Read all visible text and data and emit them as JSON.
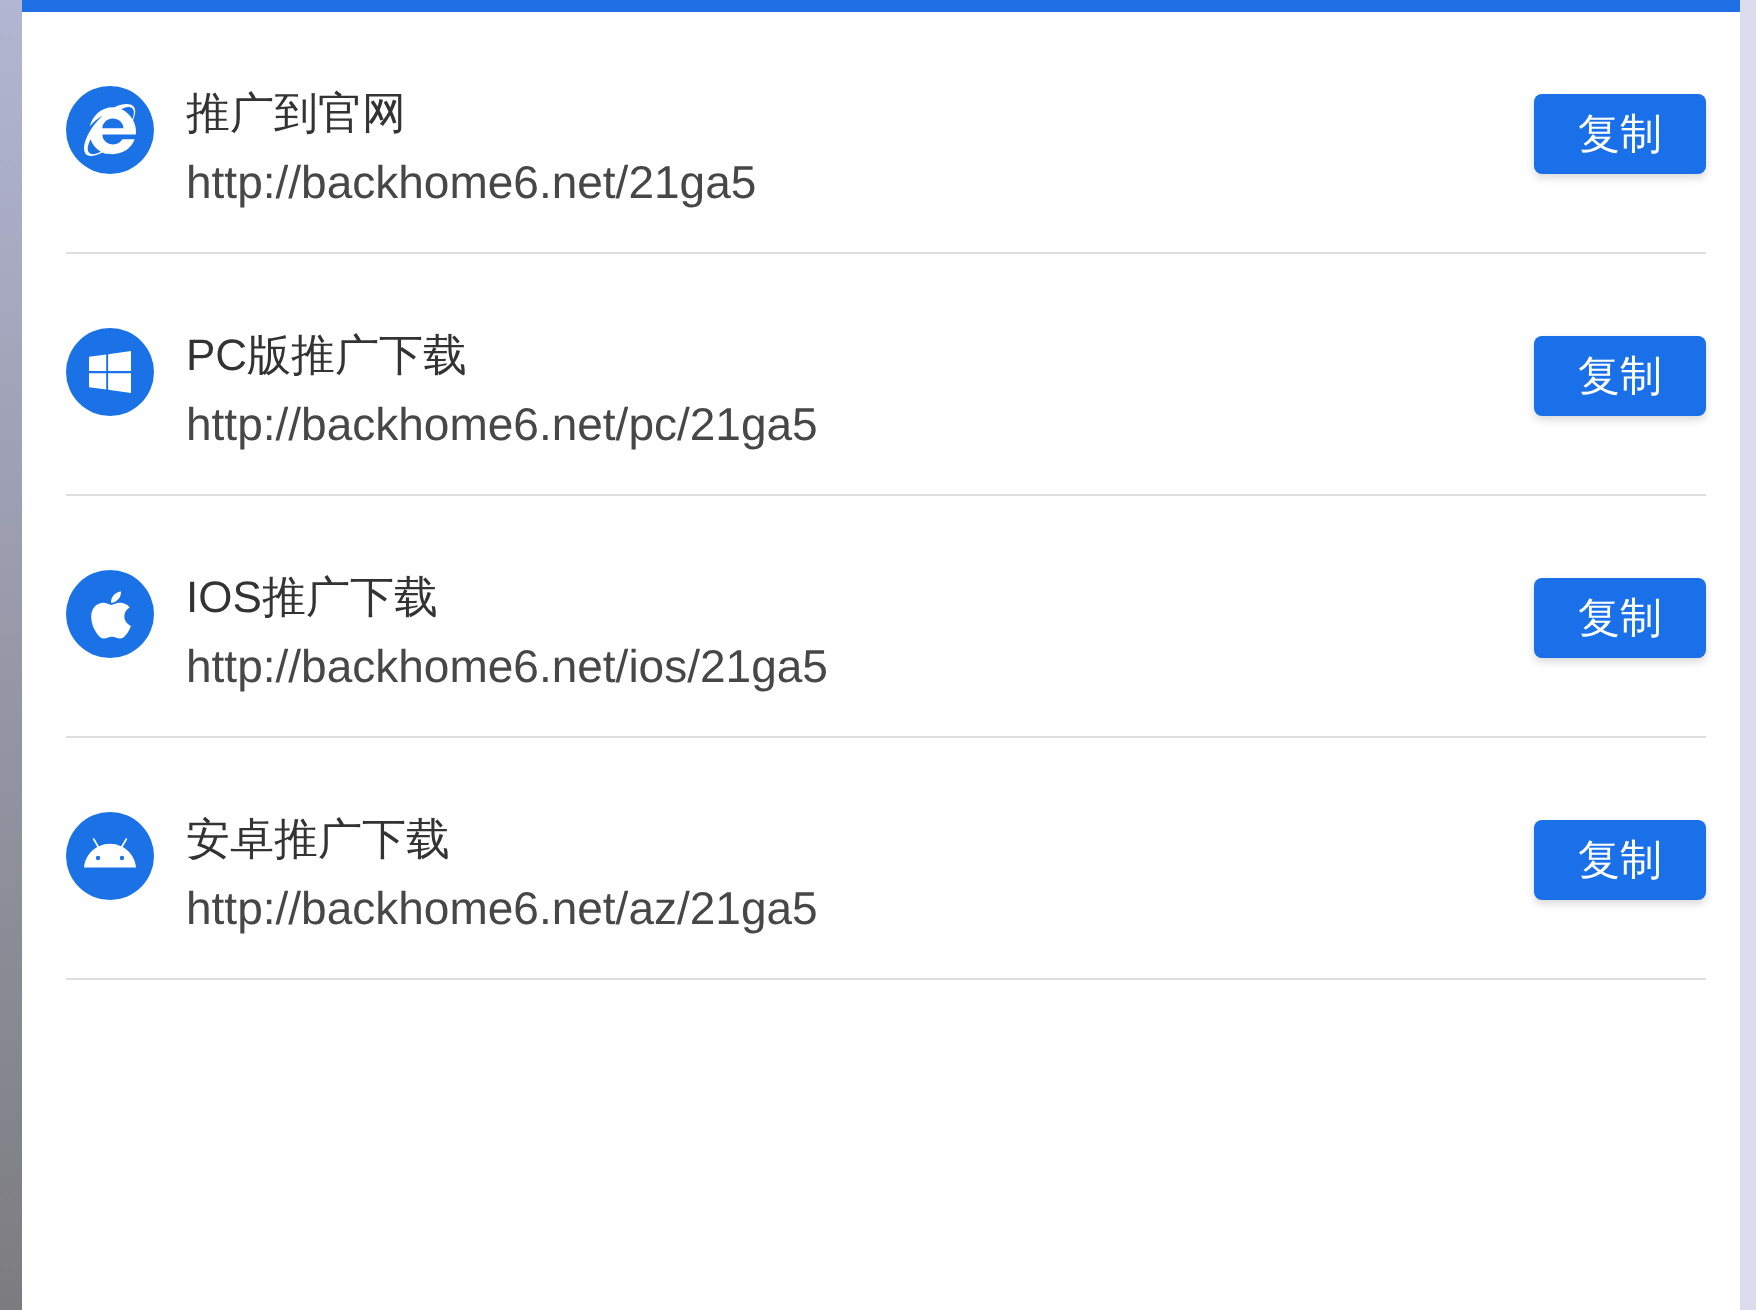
{
  "links": [
    {
      "kind": "ie",
      "title": "推广到官网",
      "url": "http://backhome6.net/21ga5",
      "button": "复制"
    },
    {
      "kind": "windows",
      "title": "PC版推广下载",
      "url": "http://backhome6.net/pc/21ga5",
      "button": "复制"
    },
    {
      "kind": "apple",
      "title": "IOS推广下载",
      "url": "http://backhome6.net/ios/21ga5",
      "button": "复制"
    },
    {
      "kind": "android",
      "title": "安卓推广下载",
      "url": "http://backhome6.net/az/21ga5",
      "button": "复制"
    }
  ]
}
